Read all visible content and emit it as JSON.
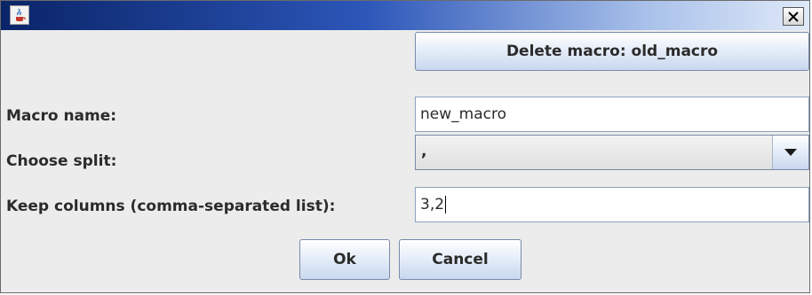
{
  "window": {
    "title": "",
    "icons": {
      "app": "java-coffee-icon",
      "close": "close-x-icon"
    }
  },
  "delete_button_label": "Delete macro: old_macro",
  "form": {
    "macro_name_label": "Macro name:",
    "macro_name_value": "new_macro",
    "split_label": "Choose split:",
    "split_value": ",",
    "keep_columns_label": "Keep columns (comma-separated list):",
    "keep_columns_value": "3,2"
  },
  "buttons": {
    "ok": "Ok",
    "cancel": "Cancel"
  },
  "colors": {
    "title_start": "#0a2468",
    "title_end": "#dfe9f8",
    "button_border": "#7a8aa8"
  }
}
